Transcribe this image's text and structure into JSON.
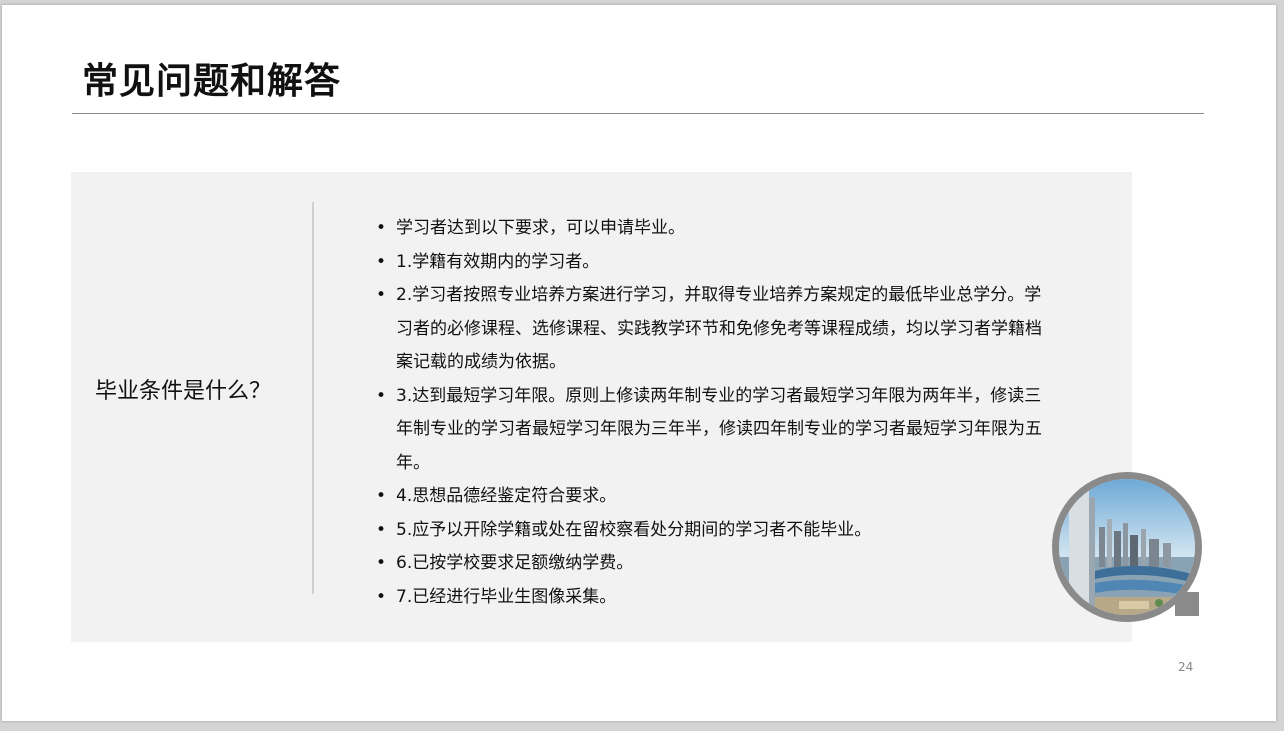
{
  "slide": {
    "title": "常见问题和解答",
    "question": "毕业条件是什么？",
    "bullet_symbol": "•",
    "answers": [
      "学习者达到以下要求，可以申请毕业。",
      "1.学籍有效期内的学习者。",
      "2.学习者按照专业培养方案进行学习，并取得专业培养方案规定的最低毕业总学分。学习者的必修课程、选修课程、实践教学环节和免修免考等课程成绩，均以学习者学籍档案记载的成绩为依据。",
      "3.达到最短学习年限。原则上修读两年制专业的学习者最短学习年限为两年半，修读三年制专业的学习者最短学习年限为三年半，修读四年制专业的学习者最短学习年限为五年。",
      "4.思想品德经鉴定符合要求。",
      "5.应予以开除学籍或处在留校察看处分期间的学习者不能毕业。",
      "6.已按学校要求足额缴纳学费。",
      "7.已经进行毕业生图像采集。"
    ],
    "page_number": "24"
  },
  "colors": {
    "panel_background": "#f2f2f2",
    "ring": "#8a8a8a",
    "text": "#111111",
    "rule": "#8a8a8a"
  }
}
